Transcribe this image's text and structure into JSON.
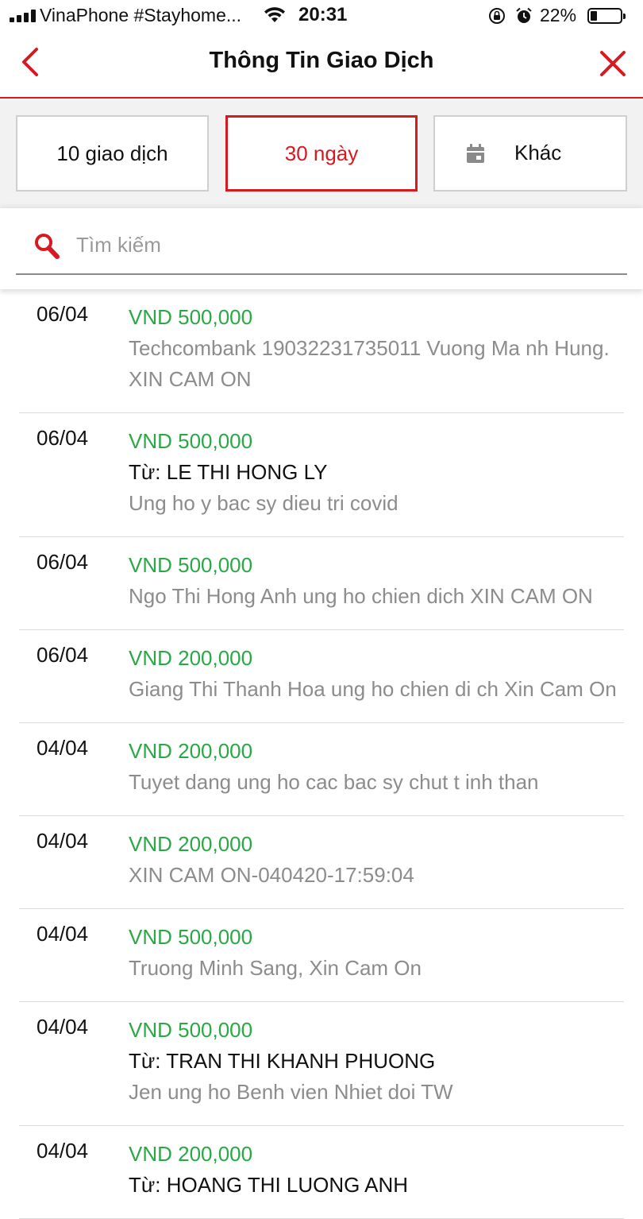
{
  "status_bar": {
    "carrier": "VinaPhone #Stayhome...",
    "time": "20:31",
    "battery_percent": "22%",
    "battery_level": 0.22
  },
  "header": {
    "title": "Thông Tin Giao Dịch",
    "back_icon": "chevron-left-icon",
    "close_icon": "close-icon",
    "accent_color": "#d71920"
  },
  "filters": {
    "tab1": "10 giao dịch",
    "tab2": "30 ngày",
    "tab3": "Khác",
    "selected": "30 ngày"
  },
  "search": {
    "placeholder": "Tìm kiếm",
    "value": ""
  },
  "transactions": [
    {
      "date": "06/04",
      "amount": "VND 500,000",
      "sender": "",
      "desc": "Techcombank 19032231735011 Vuong Ma nh Hung.",
      "desc2": "XIN CAM ON"
    },
    {
      "date": "06/04",
      "amount": "VND 500,000",
      "sender": "Từ: LE THI HONG LY",
      "desc": "Ung ho y bac sy dieu tri covid",
      "desc2": ""
    },
    {
      "date": "06/04",
      "amount": "VND 500,000",
      "sender": "",
      "desc": "Ngo Thi Hong Anh ung ho chien dich XIN CAM ON",
      "desc2": ""
    },
    {
      "date": "06/04",
      "amount": "VND 200,000",
      "sender": "",
      "desc": "Giang Thi Thanh Hoa ung ho chien di ch Xin Cam On",
      "desc2": ""
    },
    {
      "date": "04/04",
      "amount": "VND 200,000",
      "sender": "",
      "desc": "Tuyet dang ung ho cac bac sy chut t inh than",
      "desc2": ""
    },
    {
      "date": "04/04",
      "amount": "VND 200,000",
      "sender": "",
      "desc": "XIN CAM ON-040420-17:59:04",
      "desc2": ""
    },
    {
      "date": "04/04",
      "amount": "VND 500,000",
      "sender": "",
      "desc": "Truong Minh Sang, Xin Cam On",
      "desc2": ""
    },
    {
      "date": "04/04",
      "amount": "VND 500,000",
      "sender": "Từ: TRAN THI KHANH PHUONG",
      "desc": "Jen ung ho Benh vien Nhiet doi TW",
      "desc2": ""
    },
    {
      "date": "04/04",
      "amount": "VND 200,000",
      "sender": "Từ: HOANG THI LUONG ANH",
      "desc": "",
      "desc2": ""
    }
  ]
}
